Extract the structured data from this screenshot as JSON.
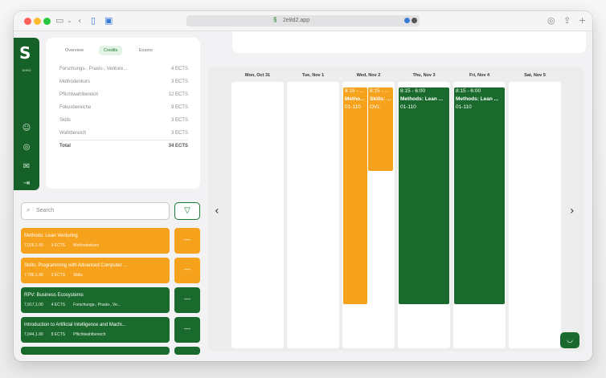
{
  "browser": {
    "url": "2e8d2.app"
  },
  "app": {
    "logo": "S",
    "logo_sub": "SHSG"
  },
  "credits": {
    "tabs": [
      {
        "label": "Overview",
        "active": false
      },
      {
        "label": "Credits",
        "active": true
      },
      {
        "label": "Exams",
        "active": false
      }
    ],
    "rows": [
      {
        "name": "Forschungs-, Praxis-, Venture...",
        "value": "4 ECTS"
      },
      {
        "name": "Methodenkurs",
        "value": "3 ECTS"
      },
      {
        "name": "Pflichtwahlbereich",
        "value": "12 ECTS"
      },
      {
        "name": "Fokusbereiche",
        "value": "9 ECTS"
      },
      {
        "name": "Skills",
        "value": "3 ECTS"
      },
      {
        "name": "Wahlbereich",
        "value": "3 ECTS"
      }
    ],
    "total": {
      "name": "Total",
      "value": "34 ECTS"
    }
  },
  "search": {
    "placeholder": "Search"
  },
  "courses": [
    {
      "title": "Methods: Lean Venturing",
      "code": "7,026,1.00",
      "ects": "3 ECTS",
      "category": "Methodenkurs",
      "color": "orange",
      "button": "—"
    },
    {
      "title": "Skills: Programming with Advanced Computer ...",
      "code": "7,786,1.00",
      "ects": "3 ECTS",
      "category": "Skills",
      "color": "orange",
      "button": "—"
    },
    {
      "title": "RPV: Business Ecosystems",
      "code": "7,917,1.00",
      "ects": "4 ECTS",
      "category": "Forschungs-, Praxis-, Ve...",
      "color": "green",
      "button": "—"
    },
    {
      "title": "Introduction to Artificial Intelligence and Machi...",
      "code": "7,044,1.00",
      "ects": "8 ECTS",
      "category": "Pflichtwahlbereich",
      "color": "green",
      "button": "—"
    }
  ],
  "calendar": {
    "days": [
      "Mon, Oct 31",
      "Tue, Nov 1",
      "Wed, Nov 2",
      "Thu, Nov 3",
      "Fri, Nov 4",
      "Sat, Nov 5"
    ],
    "events": [
      {
        "day": 2,
        "lines": [
          "8:15 - ...",
          "Metho...",
          "01-110"
        ],
        "color": "orange"
      },
      {
        "day": 2,
        "lines": [
          "8:15 - ...",
          "Skills: ...",
          "OVL"
        ],
        "color": "orange"
      },
      {
        "day": 3,
        "lines": [
          "8:15 - 6:00",
          "Methods: Lean ...",
          "01-110"
        ],
        "color": "green"
      },
      {
        "day": 4,
        "lines": [
          "8:15 - 6:00",
          "Methods: Lean ...",
          "01-110"
        ],
        "color": "green"
      }
    ]
  },
  "colors": {
    "brand_green": "#1a6a2d",
    "accent_orange": "#f6a21c"
  },
  "icons": {
    "prev": "chevron-left-icon",
    "next": "chevron-right-icon",
    "help": "chat-bot-icon"
  }
}
